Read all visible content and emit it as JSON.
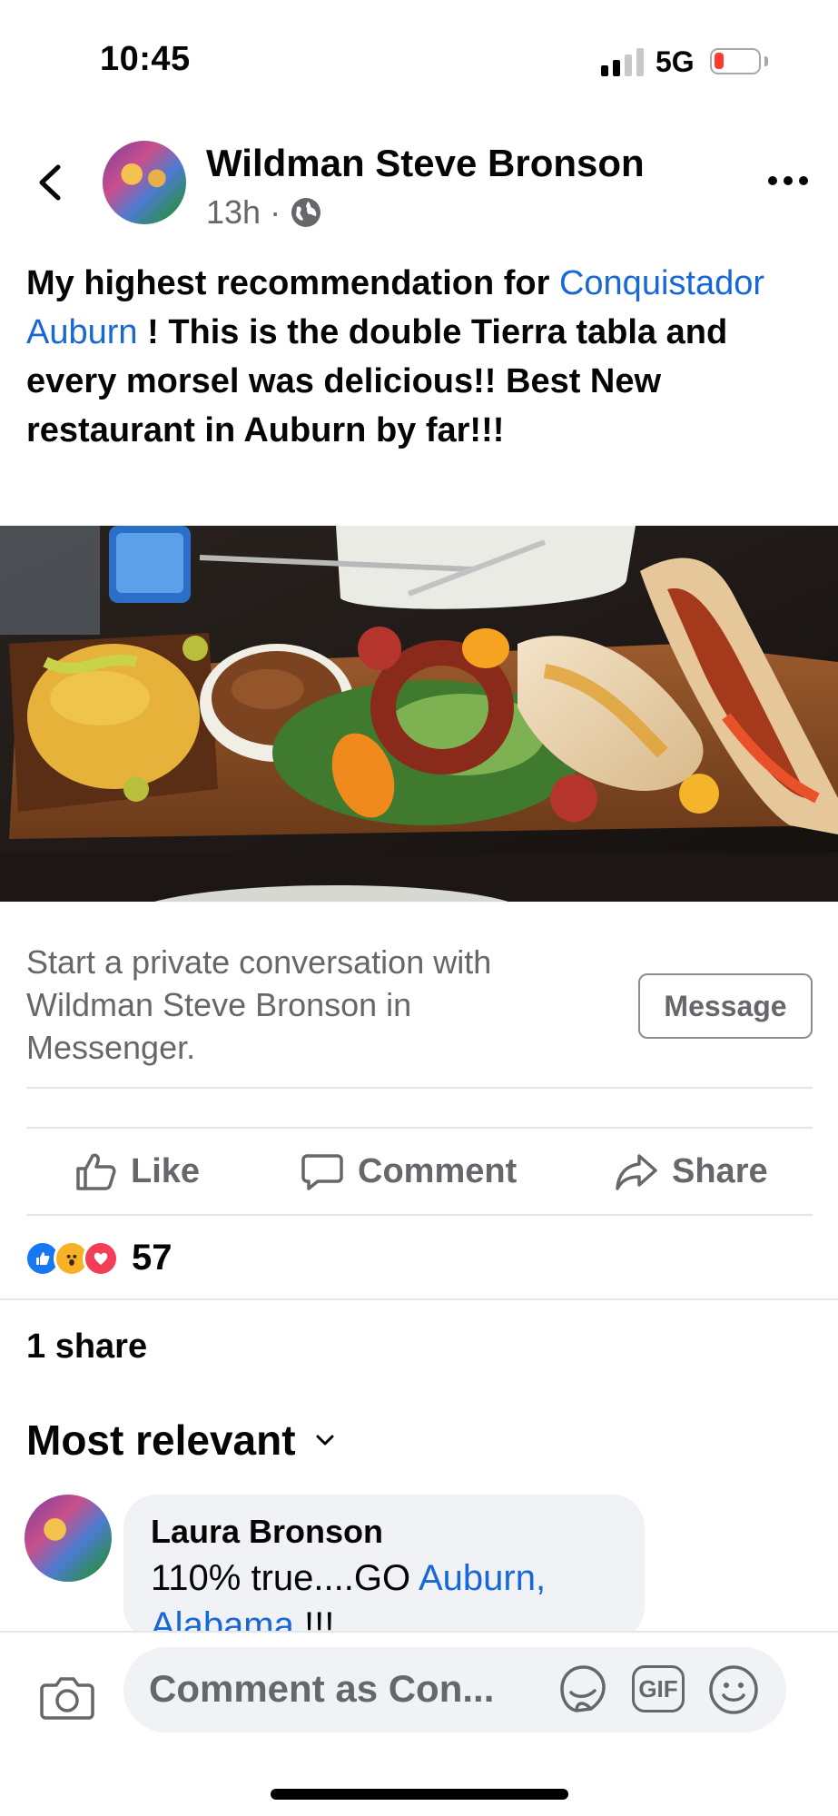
{
  "status_bar": {
    "time": "10:45",
    "network": "5G",
    "battery_level": 0.1,
    "signal_bars": 2
  },
  "post": {
    "author": "Wildman Steve Bronson",
    "time": "13h",
    "separator": "·",
    "privacy_icon": "globe-icon",
    "text_before": "My highest recommendation for ",
    "mention": "Conquistador Auburn",
    "text_after": " ! This is the double Tierra tabla and every morsel was delicious!! Best New restaurant in Auburn by far!!!",
    "photo_alt": "Photo of a wooden serving board with yellow rice, picadillo, sausage ring, grilled chicken, peppers and salad"
  },
  "messenger": {
    "prompt": "Start a private conversation with Wildman Steve Bronson in Messenger.",
    "button_label": "Message"
  },
  "actions": {
    "like": "Like",
    "comment": "Comment",
    "share": "Share"
  },
  "reactions": {
    "types": [
      "like",
      "wow",
      "love"
    ],
    "count": "57"
  },
  "shares": "1 share",
  "sort_label": "Most relevant",
  "comment": {
    "author": "Laura Bronson",
    "text_before": "110% true....GO ",
    "mention": "Auburn, Alabama",
    "text_after": " !!!"
  },
  "composer": {
    "placeholder": "Comment as Con...",
    "gif_label": "GIF"
  },
  "colors": {
    "link": "#1768d6",
    "muted": "#65676b",
    "like": "#1877f2",
    "wow": "#f7b125",
    "love": "#f33e58"
  }
}
